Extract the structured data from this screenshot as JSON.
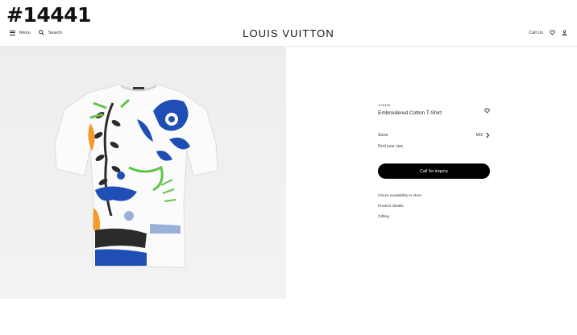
{
  "overlay": {
    "id_text": "#14441"
  },
  "header": {
    "menu_label": "Menu",
    "search_label": "Search",
    "brand": "LOUIS VUITTON",
    "call_label": "Call Us"
  },
  "product": {
    "sku": "1A9181",
    "name": "Embroidered Cotton T-Shirt",
    "size_label": "Sizes",
    "size_value": "M/2",
    "find_size": "Find your size",
    "cta_label": "Call for inquiry",
    "links": [
      "Check availability in store",
      "Product details",
      "Gifting"
    ]
  },
  "colors": {
    "cta_bg": "#000000",
    "embroidery": [
      "#1f4fb5",
      "#2b2b2b",
      "#63c44a",
      "#f39a2a",
      "#9ab0d8"
    ]
  }
}
